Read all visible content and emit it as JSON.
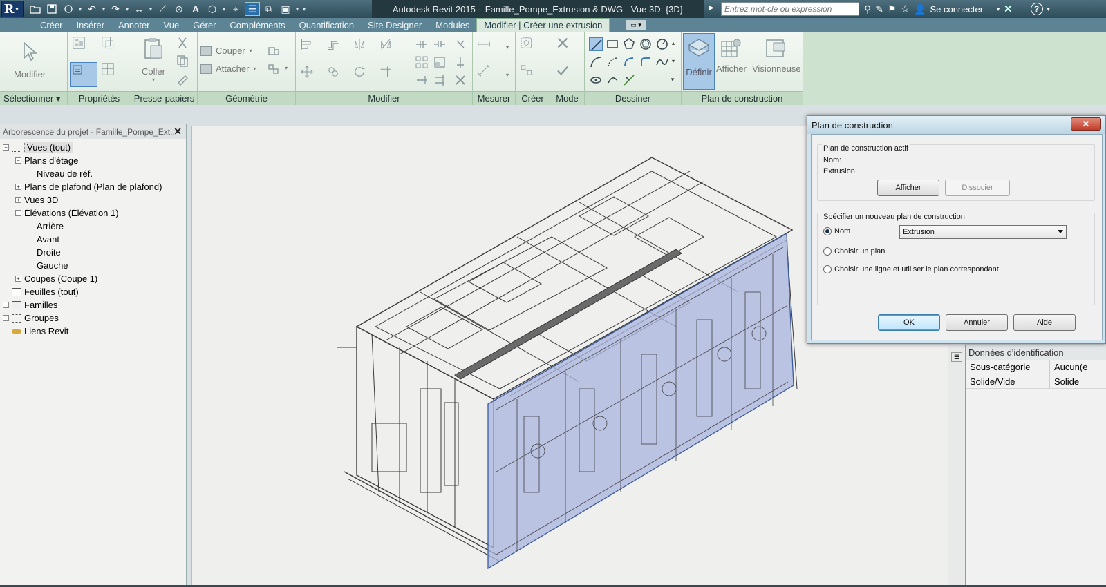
{
  "titlebar": {
    "app_title": "Autodesk Revit 2015 -",
    "doc_title": "Famille_Pompe_Extrusion & DWG - Vue 3D: {3D}",
    "search_placeholder": "Entrez mot-clé ou expression",
    "sign_in": "Se connecter",
    "help": "?"
  },
  "tabs": [
    "Créer",
    "Insérer",
    "Annoter",
    "Vue",
    "Gérer",
    "Compléments",
    "Quantification",
    "Site Designer",
    "Modules",
    "Modifier | Créer une extrusion"
  ],
  "ribbon": {
    "modify_label": "Modifier",
    "panel_select": "Sélectionner ▾",
    "panel_props": "Propriétés",
    "paste_label": "Coller",
    "panel_clipboard": "Presse-papiers",
    "cut_label": "Couper",
    "join_label": "Attacher",
    "panel_geometry": "Géométrie",
    "panel_modify": "Modifier",
    "panel_measure": "Mesurer",
    "panel_create": "Créer",
    "panel_mode": "Mode",
    "panel_draw": "Dessiner",
    "define_label": "Définir",
    "show_label": "Afficher",
    "viewer_label": "Visionneuse",
    "panel_workplane": "Plan de construction"
  },
  "browser": {
    "title": "Arborescence du projet - Famille_Pompe_Ext...",
    "close": "✕",
    "items": [
      {
        "label": "Vues (tout)",
        "level": 0,
        "exp": "−",
        "selected": true
      },
      {
        "label": "Plans d'étage",
        "level": 1,
        "exp": "−"
      },
      {
        "label": "Niveau de réf.",
        "level": 2,
        "exp": ""
      },
      {
        "label": "Plans de plafond (Plan de plafond)",
        "level": 1,
        "exp": "+"
      },
      {
        "label": "Vues 3D",
        "level": 1,
        "exp": "+"
      },
      {
        "label": "Élévations (Élévation 1)",
        "level": 1,
        "exp": "−"
      },
      {
        "label": "Arrière",
        "level": 2,
        "exp": ""
      },
      {
        "label": "Avant",
        "level": 2,
        "exp": ""
      },
      {
        "label": "Droite",
        "level": 2,
        "exp": ""
      },
      {
        "label": "Gauche",
        "level": 2,
        "exp": ""
      },
      {
        "label": "Coupes (Coupe 1)",
        "level": 1,
        "exp": "+"
      },
      {
        "label": "Feuilles (tout)",
        "level": 0,
        "exp": ""
      },
      {
        "label": "Familles",
        "level": 0,
        "exp": "+"
      },
      {
        "label": "Groupes",
        "level": 0,
        "exp": "+"
      },
      {
        "label": "Liens Revit",
        "level": 0,
        "exp": ""
      }
    ]
  },
  "properties": {
    "section": "Données d'identification",
    "rows": [
      {
        "key": "Sous-catégorie",
        "value": "Aucun(e"
      },
      {
        "key": "Solide/Vide",
        "value": "Solide"
      }
    ]
  },
  "dialog": {
    "title": "Plan de construction",
    "close": "✕",
    "active_group": "Plan de construction actif",
    "name_label": "Nom:",
    "name_value": "Extrusion",
    "show_btn": "Afficher",
    "dissociate_btn": "Dissocier",
    "new_group": "Spécifier un nouveau plan de construction",
    "opt_name": "Nom",
    "combo_value": "Extrusion",
    "opt_pick_plane": "Choisir un plan",
    "opt_pick_line": "Choisir une ligne et utiliser le plan correspondant",
    "ok": "OK",
    "cancel": "Annuler",
    "help": "Aide"
  },
  "colors": {
    "ribbon_bg": "#cde3cf",
    "tab_bar": "#5d8494",
    "extrusion_fill": "#aab4de",
    "wire": "#3a3a3a"
  }
}
